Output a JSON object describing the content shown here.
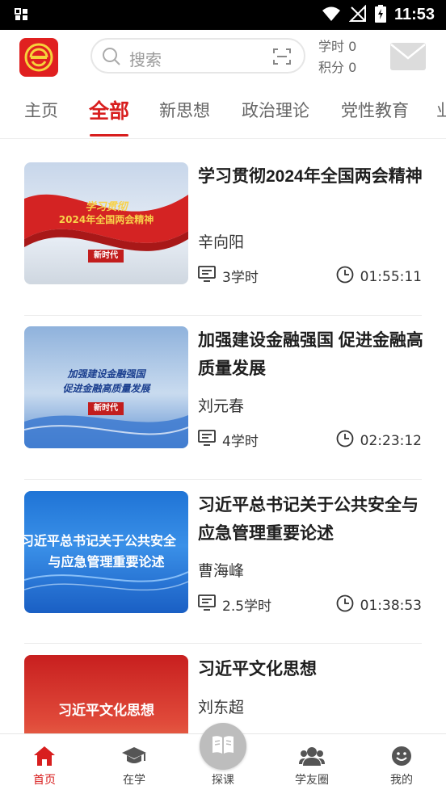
{
  "status_bar": {
    "time": "11:53"
  },
  "header": {
    "search_placeholder": "搜索",
    "study_hours": "学时 0",
    "points": "积分 0"
  },
  "tabs": [
    {
      "label": "主页"
    },
    {
      "label": "全部"
    },
    {
      "label": "新思想"
    },
    {
      "label": "政治理论"
    },
    {
      "label": "党性教育"
    }
  ],
  "courses": [
    {
      "title": "学习贯彻2024年全国两会精神",
      "author": "辛向阳",
      "hours": "3学时",
      "duration": "01:55:11",
      "thumb_line1": "学习贯彻",
      "thumb_line2": "2024年全国两会精神",
      "thumb_badge": "新时代"
    },
    {
      "title": "加强建设金融强国 促进金融高质量发展",
      "author": "刘元春",
      "hours": "4学时",
      "duration": "02:23:12",
      "thumb_line1": "加强建设金融强国",
      "thumb_line2": "促进金融高质量发展",
      "thumb_badge": "新时代"
    },
    {
      "title": "习近平总书记关于公共安全与应急管理重要论述",
      "author": "曹海峰",
      "hours": "2.5学时",
      "duration": "01:38:53",
      "thumb_line1": "习近平总书记关于公共安全",
      "thumb_line2": "与应急管理重要论述"
    },
    {
      "title": "习近平文化思想",
      "author": "刘东超",
      "thumb_line1": "习近平文化思想"
    }
  ],
  "bottom_nav": [
    {
      "label": "首页",
      "icon": "home-icon"
    },
    {
      "label": "在学",
      "icon": "graduation-cap-icon"
    },
    {
      "label": "探课",
      "icon": "book-icon"
    },
    {
      "label": "学友圈",
      "icon": "people-icon"
    },
    {
      "label": "我的",
      "icon": "smiley-icon"
    }
  ],
  "colors": {
    "accent": "#d81e1e",
    "logo_bg": "#e02020"
  }
}
